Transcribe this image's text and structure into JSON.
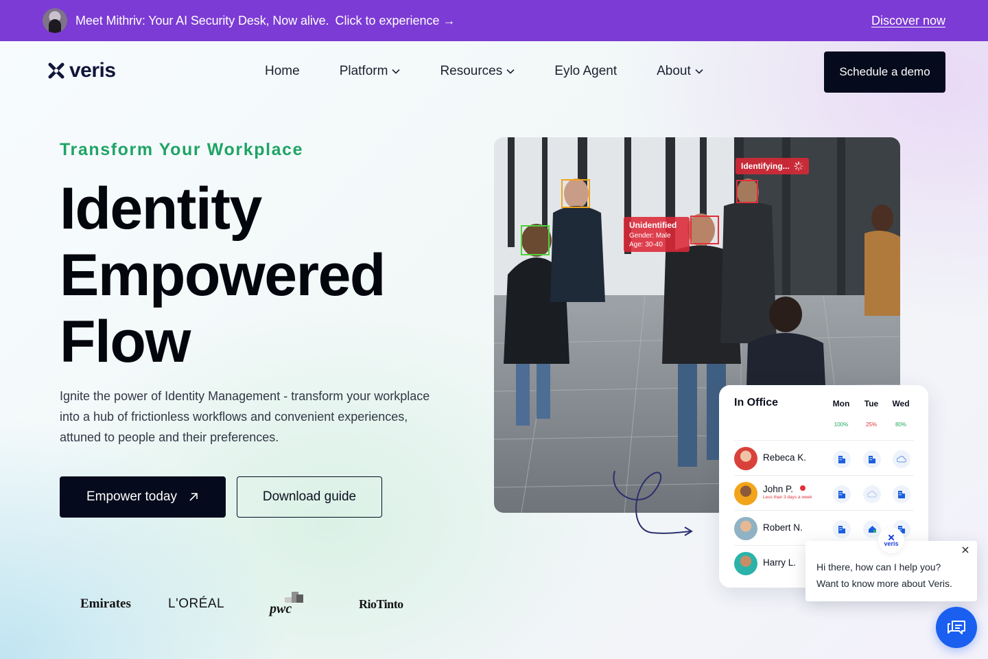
{
  "announcement": {
    "message": "Meet Mithriv: Your AI Security Desk, Now alive.",
    "cta": "Click to experience →",
    "discover": "Discover now"
  },
  "nav": {
    "logo_text": "veris",
    "links": [
      {
        "label": "Home",
        "has_menu": false
      },
      {
        "label": "Platform",
        "has_menu": true
      },
      {
        "label": "Resources",
        "has_menu": true
      },
      {
        "label": "Eylo Agent",
        "has_menu": false
      },
      {
        "label": "About",
        "has_menu": true
      }
    ],
    "demo_button": "Schedule a demo"
  },
  "hero": {
    "eyebrow": "Transform Your Workplace",
    "headline_lines": [
      "Identity",
      "Empowered",
      "Flow"
    ],
    "lede": "Ignite the power of Identity Management - transform your workplace into a hub of frictionless workflows and convenient experiences, attuned to people and their preferences.",
    "primary_button": "Empower today",
    "secondary_button": "Download guide"
  },
  "client_logos": [
    "Emirates",
    "L'ORÉAL",
    "pwc",
    "RioTinto"
  ],
  "photo_overlays": {
    "identifying": "Identifying...",
    "unidentified_title": "Unidentified",
    "unidentified_gender": "Gender: Male",
    "unidentified_age": "Age: 30-40"
  },
  "in_office": {
    "title": "In Office",
    "days": [
      {
        "label": "Mon",
        "pct": "100%",
        "color": "#22a861"
      },
      {
        "label": "Tue",
        "pct": "25%",
        "color": "#e0303a"
      },
      {
        "label": "Wed",
        "pct": "80%",
        "color": "#22a861"
      }
    ],
    "people": [
      {
        "name": "Rebeca K.",
        "warning": "",
        "status": [
          "office",
          "office",
          "remote"
        ],
        "avatar_color": "#d9413b"
      },
      {
        "name": "John P.",
        "warning": "Less than 3 days a week",
        "status": [
          "office",
          "remote",
          "office"
        ],
        "avatar_color": "#f2a51a"
      },
      {
        "name": "Robert N.",
        "warning": "",
        "status": [
          "office",
          "home",
          "office"
        ],
        "avatar_color": "#8fb2c4"
      },
      {
        "name": "Harry L.",
        "warning": "",
        "status": [
          "office",
          "office",
          "office"
        ],
        "avatar_color": "#2bb3a9"
      }
    ]
  },
  "chat": {
    "avatar_label": "veris",
    "line1": "Hi there, how can I help you?",
    "line2": "Want to know more about Veris."
  },
  "colors": {
    "announcement_bg": "#7c3bd4",
    "eyebrow": "#1fa465",
    "dark_button": "#050b1c",
    "chat_launcher": "#1a5ff0"
  },
  "icons": [
    "veris-logo-icon",
    "chevron-down-icon",
    "arrow-up-right-icon",
    "office-building-icon",
    "remote-cloud-icon",
    "home-icon",
    "close-icon",
    "chat-icon"
  ]
}
